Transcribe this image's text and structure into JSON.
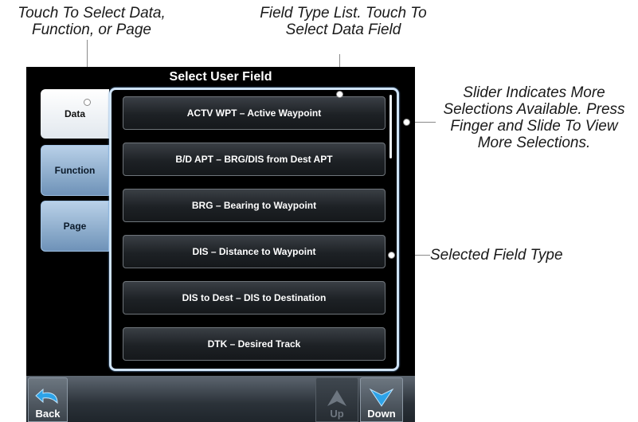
{
  "annotations": {
    "select_tabs": {
      "line1": "Touch To Select Data,",
      "line2": "Function, or Page"
    },
    "field_type_list": {
      "line1": "Field Type List. Touch To",
      "line2": "Select Data Field"
    },
    "slider": {
      "line1": "Slider Indicates More",
      "line2": "Selections Available. Press",
      "line3": "Finger and Slide To View",
      "line4": "More Selections."
    },
    "selected_field": {
      "line1": "Selected Field Type"
    }
  },
  "screen": {
    "title": "Select User Field",
    "tabs": [
      {
        "label": "Data",
        "active": true
      },
      {
        "label": "Function",
        "active": false
      },
      {
        "label": "Page",
        "active": false
      }
    ],
    "fields": [
      {
        "label": "ACTV WPT – Active Waypoint"
      },
      {
        "label": "B/D APT – BRG/DIS from Dest APT"
      },
      {
        "label": "BRG – Bearing to Waypoint"
      },
      {
        "label": "DIS – Distance to Waypoint"
      },
      {
        "label": "DIS to Dest – DIS to Destination"
      },
      {
        "label": "DTK – Desired Track"
      }
    ],
    "bottom_bar": {
      "back_label": "Back",
      "up_label": "Up",
      "down_label": "Down",
      "up_enabled": false,
      "down_enabled": true
    }
  },
  "icons": {
    "back": "back-arrow-icon",
    "up": "up-arrow-icon",
    "down": "down-arrow-icon"
  },
  "colors": {
    "panel_border": "#cfe3f7",
    "tab_inactive": "#8fb1d4",
    "down_arrow": "#2da3e8",
    "up_arrow_disabled": "#6d7680"
  }
}
